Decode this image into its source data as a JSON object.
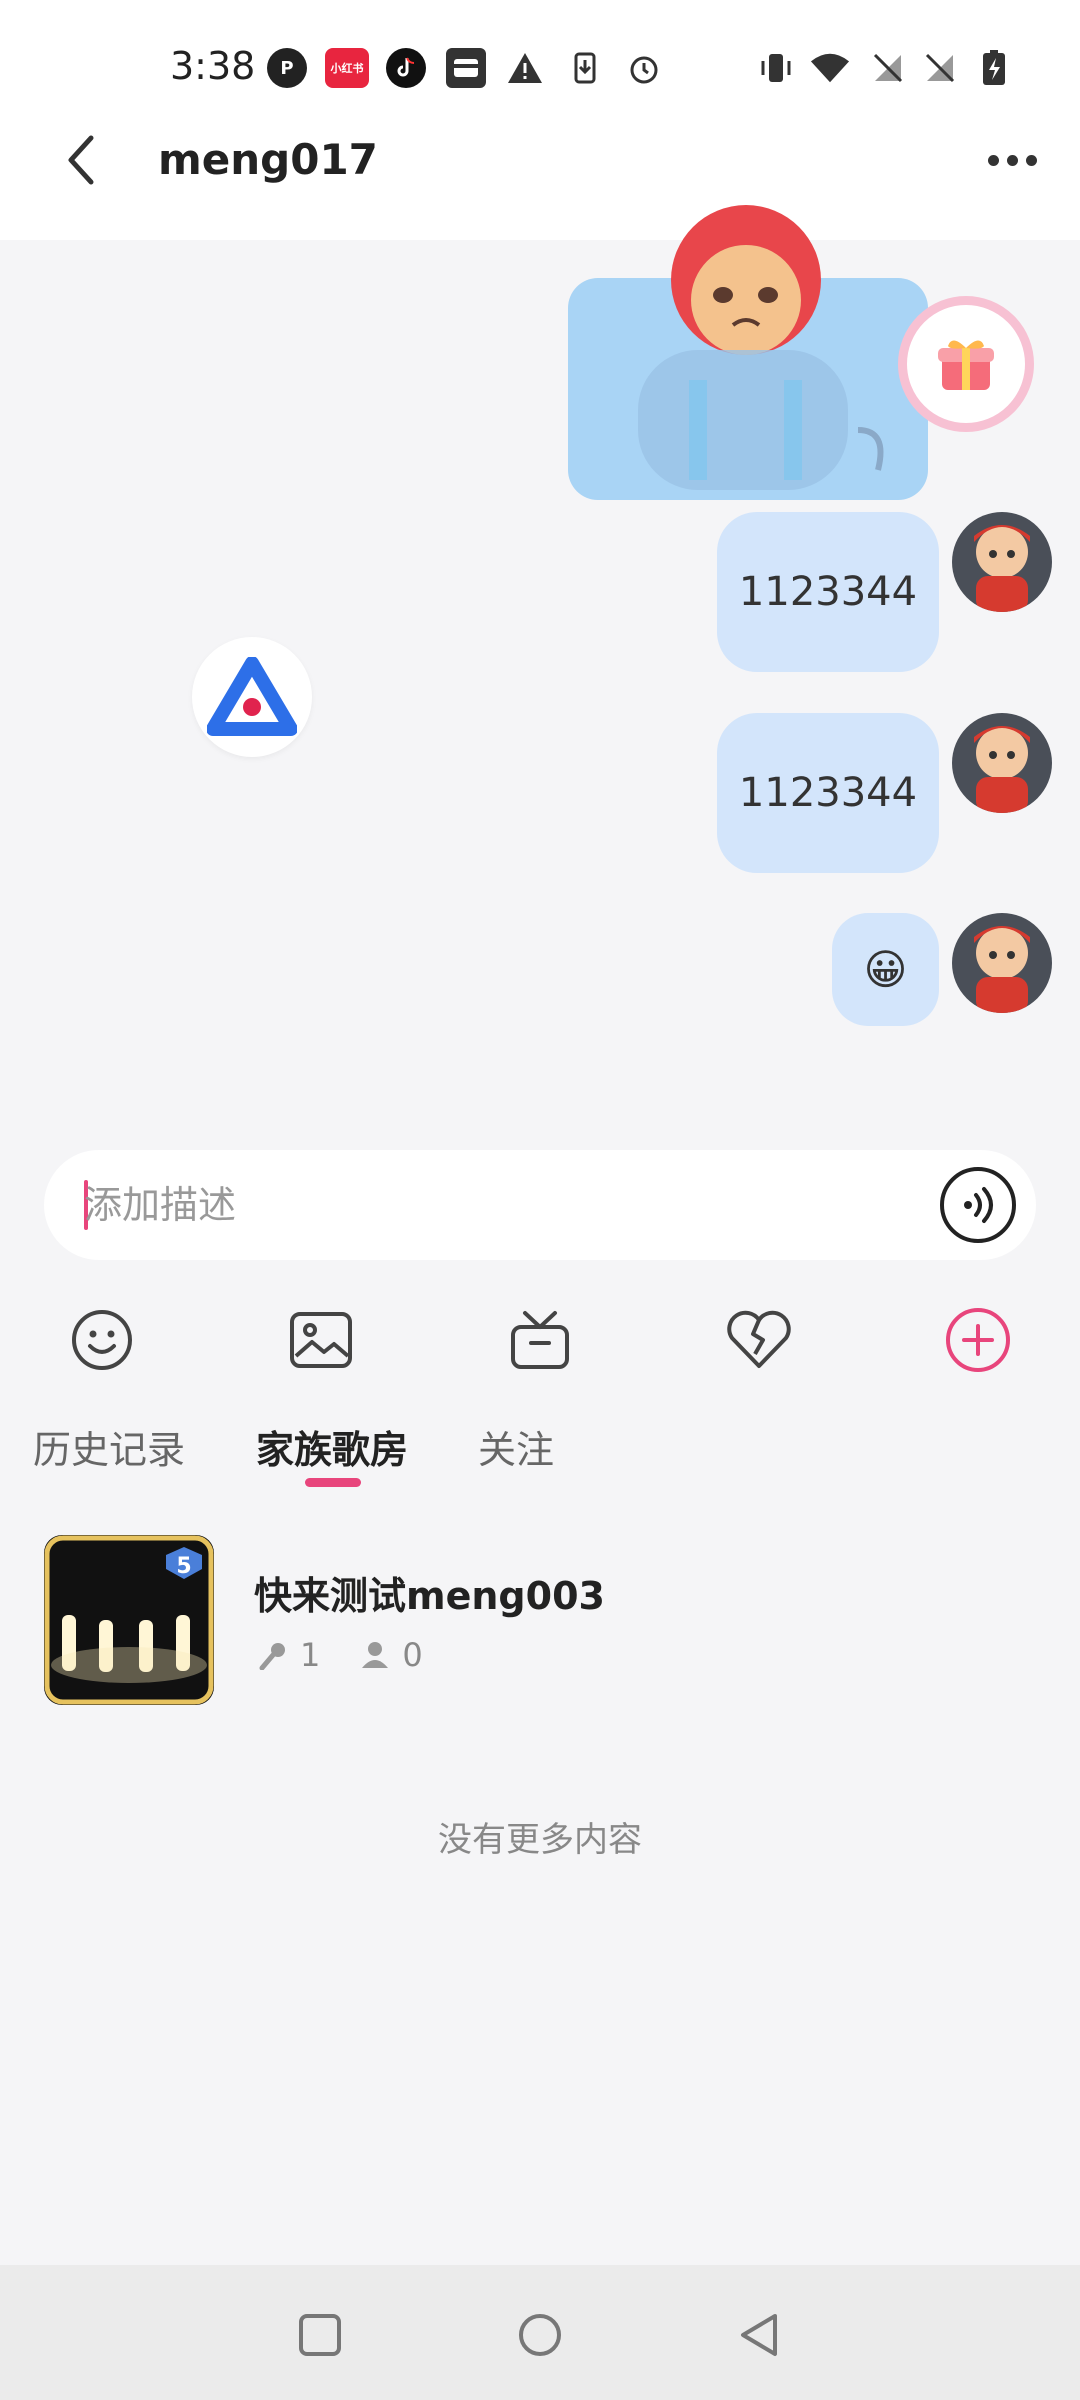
{
  "status_bar": {
    "time": "3:38",
    "app_icons": [
      "parking-icon",
      "xiaohongshu-icon",
      "tiktok-icon",
      "wallet-icon",
      "warning-icon",
      "download-icon",
      "alarm-icon"
    ],
    "system_icons": [
      "vibrate-icon",
      "wifi-icon",
      "no-sim-icon",
      "no-sim-icon",
      "battery-charging-icon"
    ],
    "xiaohongshu_label": "小红书"
  },
  "header": {
    "title": "meng017"
  },
  "chat": {
    "messages": [
      {
        "type": "sticker",
        "sender": "self"
      },
      {
        "type": "text",
        "text": "1123344",
        "sender": "self"
      },
      {
        "type": "text",
        "text": "1123344",
        "sender": "self"
      },
      {
        "type": "emoji",
        "text": "😀",
        "sender": "self"
      }
    ]
  },
  "input": {
    "placeholder": "添加描述",
    "value": ""
  },
  "toolbar": {
    "items": [
      "emoji-icon",
      "image-icon",
      "gift-box-icon",
      "heart-icon",
      "add-icon"
    ]
  },
  "tabs": [
    {
      "label": "历史记录",
      "active": false
    },
    {
      "label": "家族歌房",
      "active": true
    },
    {
      "label": "关注",
      "active": false
    }
  ],
  "rooms": [
    {
      "name": "快来测试meng003",
      "mic_count": "1",
      "people_count": "0",
      "level": "5"
    }
  ],
  "no_more_text": "没有更多内容",
  "colors": {
    "accent": "#e8457c",
    "bubble": "#d3e5fb",
    "background": "#f5f5f7"
  }
}
